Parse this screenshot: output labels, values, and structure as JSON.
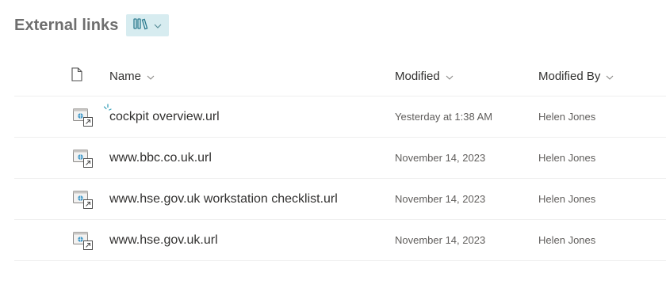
{
  "library": {
    "title": "External links",
    "view_icon": "library-view-icon",
    "view_chevron": "chevron-down-icon"
  },
  "columns": {
    "type_icon": "document-icon",
    "name": "Name",
    "modified": "Modified",
    "modified_by": "Modified By"
  },
  "rows": [
    {
      "name": "cockpit overview.url",
      "modified": "Yesterday at 1:38 AM",
      "modified_by": "Helen Jones",
      "is_new": true,
      "icon": "url-shortcut-icon"
    },
    {
      "name": "www.bbc.co.uk.url",
      "modified": "November 14, 2023",
      "modified_by": "Helen Jones",
      "is_new": false,
      "icon": "url-shortcut-icon"
    },
    {
      "name": "www.hse.gov.uk workstation checklist.url",
      "modified": "November 14, 2023",
      "modified_by": "Helen Jones",
      "is_new": false,
      "icon": "url-shortcut-icon"
    },
    {
      "name": "www.hse.gov.uk.url",
      "modified": "November 14, 2023",
      "modified_by": "Helen Jones",
      "is_new": false,
      "icon": "url-shortcut-icon"
    }
  ],
  "colors": {
    "accent": "#2b7a8e",
    "view_button_bg": "#d7ecf0",
    "new_indicator": "#2b9ab5"
  }
}
